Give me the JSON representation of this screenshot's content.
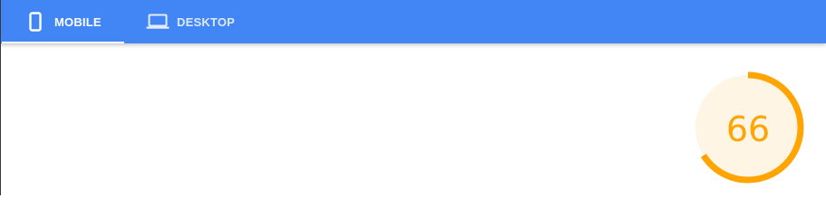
{
  "tabs": [
    {
      "label": "MOBILE",
      "icon": "smartphone-icon",
      "selected": true
    },
    {
      "label": "DESKTOP",
      "icon": "laptop-icon",
      "selected": false
    }
  ],
  "score_gauge": {
    "score": "66",
    "value": 66,
    "max": 100,
    "color": "#ffa400",
    "fill_color": "#fff5e5"
  },
  "colors": {
    "tabbar": "#4285f4",
    "tab_text": "#ffffff"
  }
}
